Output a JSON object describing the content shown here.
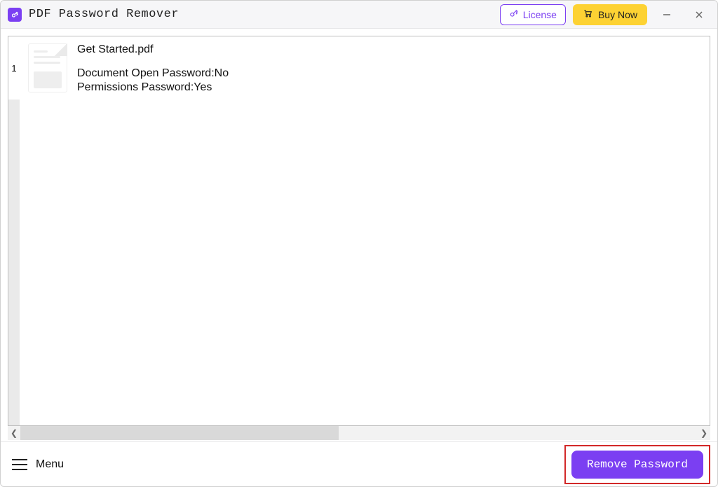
{
  "app": {
    "title": "PDF Password Remover"
  },
  "titlebar": {
    "license_label": "License",
    "buy_label": "Buy Now"
  },
  "files": [
    {
      "index": "1",
      "name": "Get Started.pdf",
      "open_password_label": "Document Open Password:",
      "open_password_value": "No",
      "permissions_password_label": "Permissions Password:",
      "permissions_password_value": "Yes"
    }
  ],
  "footer": {
    "menu_label": "Menu",
    "remove_label": "Remove Password"
  },
  "colors": {
    "accent": "#7b3ff2",
    "buy": "#fdd233",
    "highlight_border": "#d22828"
  }
}
